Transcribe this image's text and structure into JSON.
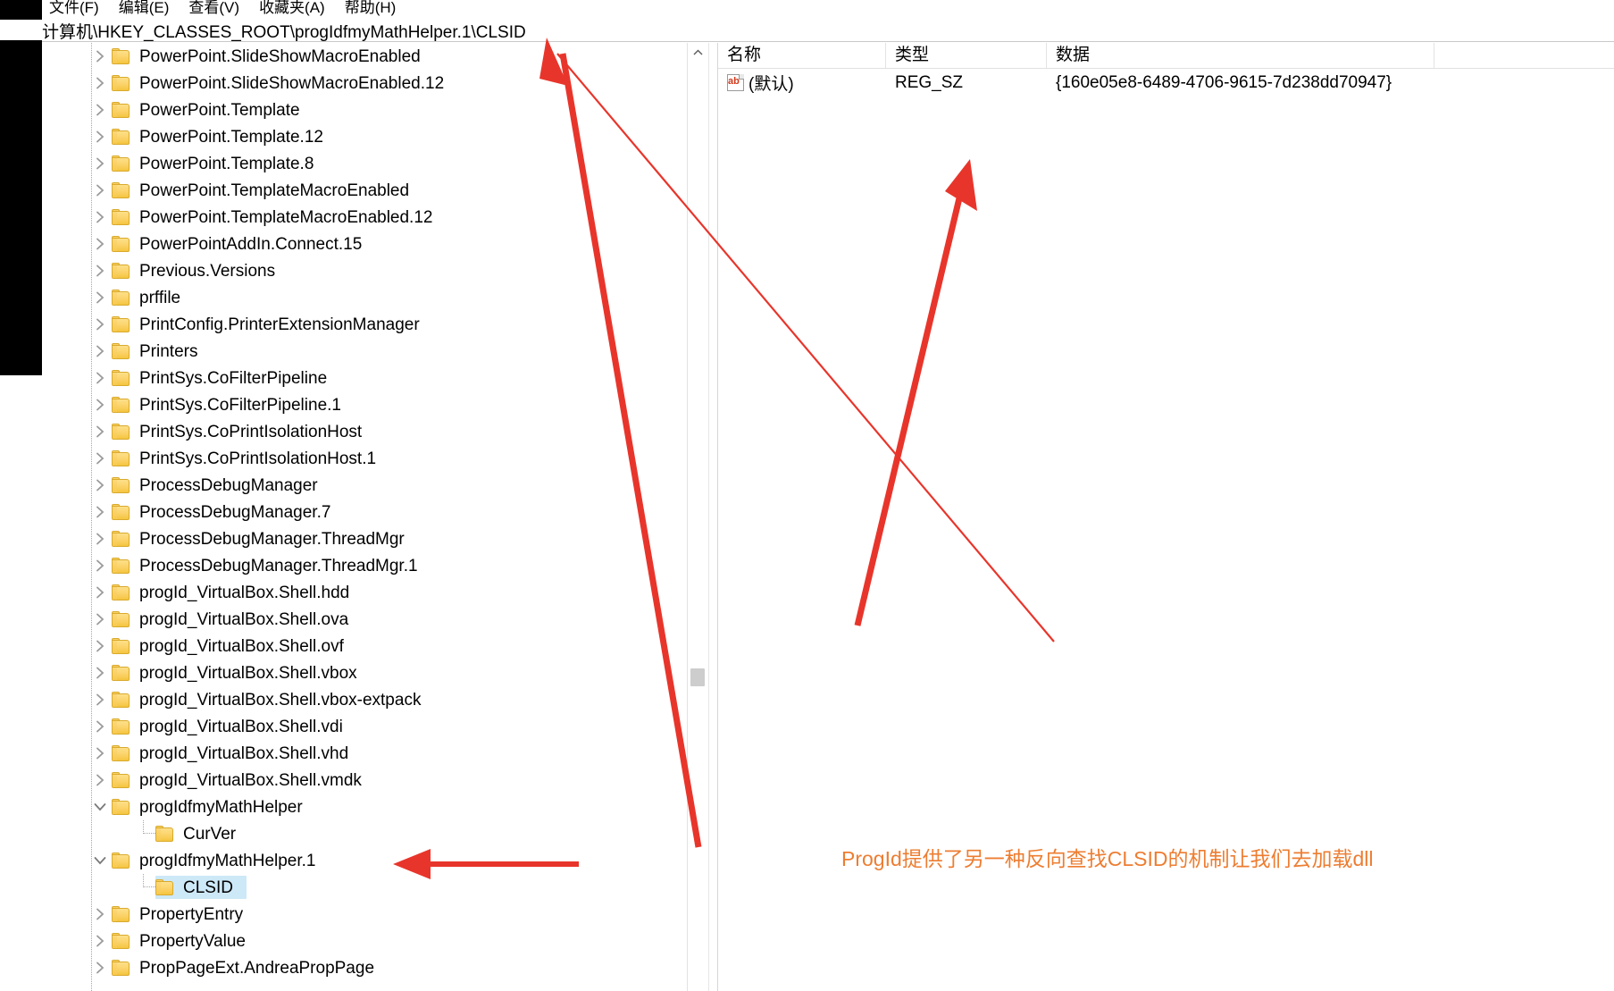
{
  "window": {
    "menus": [
      {
        "label": "文件(F)",
        "accel": "F"
      },
      {
        "label": "编辑(E)",
        "accel": "E"
      },
      {
        "label": "查看(V)",
        "accel": "V"
      },
      {
        "label": "收藏夹(A)",
        "accel": "A"
      },
      {
        "label": "帮助(H)",
        "accel": "H"
      }
    ],
    "address": "计算机\\HKEY_CLASSES_ROOT\\progIdfmyMathHelper.1\\CLSID"
  },
  "tree": {
    "items": [
      {
        "label": "PowerPoint.SlideShowMacroEnabled",
        "level": 1,
        "state": "collapsed",
        "selected": false
      },
      {
        "label": "PowerPoint.SlideShowMacroEnabled.12",
        "level": 1,
        "state": "collapsed",
        "selected": false
      },
      {
        "label": "PowerPoint.Template",
        "level": 1,
        "state": "collapsed",
        "selected": false
      },
      {
        "label": "PowerPoint.Template.12",
        "level": 1,
        "state": "collapsed",
        "selected": false
      },
      {
        "label": "PowerPoint.Template.8",
        "level": 1,
        "state": "collapsed",
        "selected": false
      },
      {
        "label": "PowerPoint.TemplateMacroEnabled",
        "level": 1,
        "state": "collapsed",
        "selected": false
      },
      {
        "label": "PowerPoint.TemplateMacroEnabled.12",
        "level": 1,
        "state": "collapsed",
        "selected": false
      },
      {
        "label": "PowerPointAddIn.Connect.15",
        "level": 1,
        "state": "collapsed",
        "selected": false
      },
      {
        "label": "Previous.Versions",
        "level": 1,
        "state": "collapsed",
        "selected": false
      },
      {
        "label": "prffile",
        "level": 1,
        "state": "collapsed",
        "selected": false
      },
      {
        "label": "PrintConfig.PrinterExtensionManager",
        "level": 1,
        "state": "collapsed",
        "selected": false
      },
      {
        "label": "Printers",
        "level": 1,
        "state": "collapsed",
        "selected": false
      },
      {
        "label": "PrintSys.CoFilterPipeline",
        "level": 1,
        "state": "collapsed",
        "selected": false
      },
      {
        "label": "PrintSys.CoFilterPipeline.1",
        "level": 1,
        "state": "collapsed",
        "selected": false
      },
      {
        "label": "PrintSys.CoPrintIsolationHost",
        "level": 1,
        "state": "collapsed",
        "selected": false
      },
      {
        "label": "PrintSys.CoPrintIsolationHost.1",
        "level": 1,
        "state": "collapsed",
        "selected": false
      },
      {
        "label": "ProcessDebugManager",
        "level": 1,
        "state": "collapsed",
        "selected": false
      },
      {
        "label": "ProcessDebugManager.7",
        "level": 1,
        "state": "collapsed",
        "selected": false
      },
      {
        "label": "ProcessDebugManager.ThreadMgr",
        "level": 1,
        "state": "collapsed",
        "selected": false
      },
      {
        "label": "ProcessDebugManager.ThreadMgr.1",
        "level": 1,
        "state": "collapsed",
        "selected": false
      },
      {
        "label": "progId_VirtualBox.Shell.hdd",
        "level": 1,
        "state": "collapsed",
        "selected": false
      },
      {
        "label": "progId_VirtualBox.Shell.ova",
        "level": 1,
        "state": "collapsed",
        "selected": false
      },
      {
        "label": "progId_VirtualBox.Shell.ovf",
        "level": 1,
        "state": "collapsed",
        "selected": false
      },
      {
        "label": "progId_VirtualBox.Shell.vbox",
        "level": 1,
        "state": "collapsed",
        "selected": false
      },
      {
        "label": "progId_VirtualBox.Shell.vbox-extpack",
        "level": 1,
        "state": "collapsed",
        "selected": false
      },
      {
        "label": "progId_VirtualBox.Shell.vdi",
        "level": 1,
        "state": "collapsed",
        "selected": false
      },
      {
        "label": "progId_VirtualBox.Shell.vhd",
        "level": 1,
        "state": "collapsed",
        "selected": false
      },
      {
        "label": "progId_VirtualBox.Shell.vmdk",
        "level": 1,
        "state": "collapsed",
        "selected": false
      },
      {
        "label": "progIdfmyMathHelper",
        "level": 1,
        "state": "expanded",
        "selected": false
      },
      {
        "label": "CurVer",
        "level": 2,
        "state": "leaf",
        "selected": false
      },
      {
        "label": "progIdfmyMathHelper.1",
        "level": 1,
        "state": "expanded",
        "selected": false
      },
      {
        "label": "CLSID",
        "level": 2,
        "state": "leaf",
        "selected": true
      },
      {
        "label": "PropertyEntry",
        "level": 1,
        "state": "collapsed",
        "selected": false
      },
      {
        "label": "PropertyValue",
        "level": 1,
        "state": "collapsed",
        "selected": false
      },
      {
        "label": "PropPageExt.AndreaPropPage",
        "level": 1,
        "state": "collapsed",
        "selected": false
      }
    ]
  },
  "list": {
    "columns": [
      "名称",
      "类型",
      "数据"
    ],
    "rows": [
      {
        "icon": "string-value-icon",
        "name": "(默认)",
        "type": "REG_SZ",
        "data": "{160e05e8-6489-4706-9615-7d238dd70947}"
      }
    ]
  },
  "annotations": {
    "note_text": "ProgId提供了另一种反向查找CLSID的机制让我们去加载dll",
    "note_color": "#ED7D31",
    "arrow_color": "#E8352B",
    "marks": [
      {
        "name": "arrow-to-address-bar",
        "kind": "arrow"
      },
      {
        "name": "arrow-to-data-value",
        "kind": "arrow"
      },
      {
        "name": "arrow-to-progid-node",
        "kind": "arrow"
      }
    ]
  }
}
